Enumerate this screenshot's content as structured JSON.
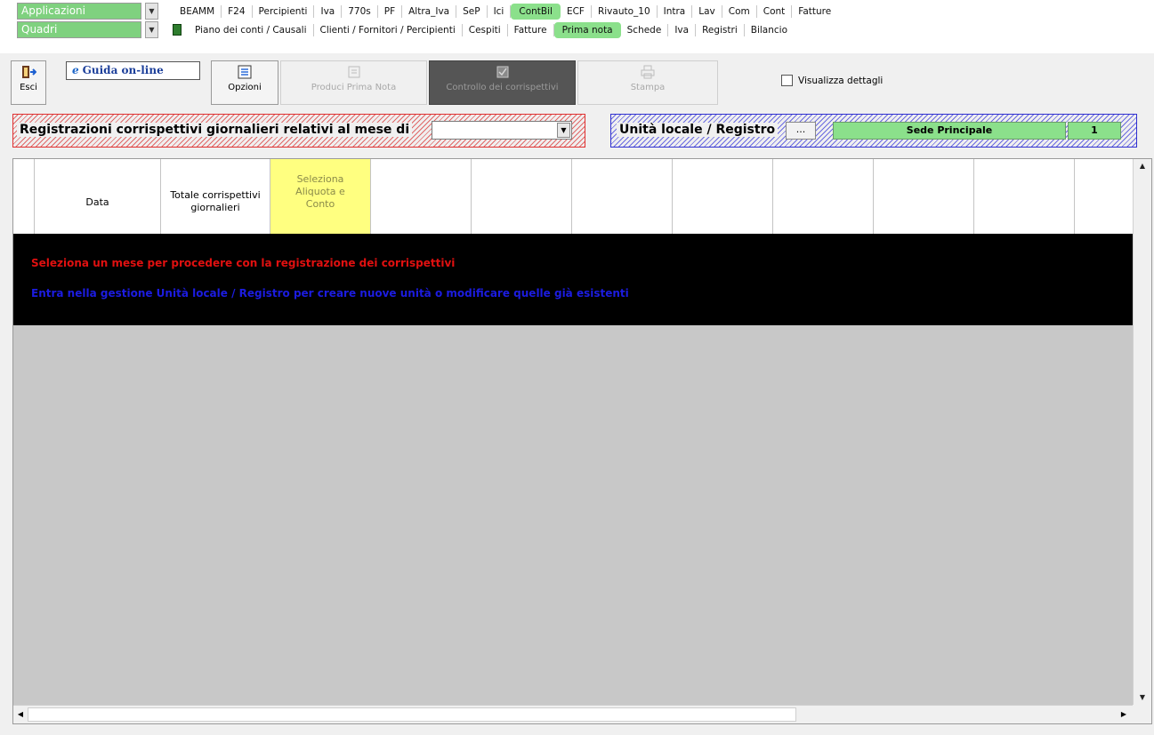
{
  "topbar": {
    "applicazioni": "Applicazioni",
    "quadri": "Quadri",
    "apps": [
      "BEAMM",
      "F24",
      "Percipienti",
      "Iva",
      "770s",
      "PF",
      "Altra_Iva",
      "SeP",
      "Ici",
      "ContBil",
      "ECF",
      "Rivauto_10",
      "Intra",
      "Lav",
      "Com",
      "Cont",
      "Fatture"
    ],
    "active_app": "ContBil",
    "sections": [
      "Piano dei conti / Causali",
      "Clienti / Fornitori / Percipienti",
      "Cespiti",
      "Fatture",
      "Prima nota",
      "Schede",
      "Iva",
      "Registri",
      "Bilancio"
    ],
    "active_section": "Prima nota"
  },
  "toolbar": {
    "esci": "Esci",
    "guida": "Guida on-line",
    "opzioni": "Opzioni",
    "produci": "Produci Prima Nota",
    "controllo": "Controllo dei corrispettivi",
    "stampa": "Stampa",
    "visualizza": "Visualizza dettagli"
  },
  "filter": {
    "month_label": "Registrazioni corrispettivi giornalieri relativi al mese di",
    "month_value": "",
    "unit_label": "Unità locale / Registro",
    "dots": "...",
    "sede": "Sede Principale",
    "registro_num": "1"
  },
  "grid": {
    "col_data": "Data",
    "col_totale": "Totale corrispettivi giornalieri",
    "col_seleziona": "Seleziona Aliquota e Conto",
    "msg_red": "Seleziona un mese per procedere con la registrazione dei corrispettivi",
    "msg_blue": "Entra nella gestione Unità locale / Registro per creare nuove unità o modificare quelle già esistenti"
  },
  "colors": {
    "accent_green": "#8be08b",
    "message_red": "#e01010",
    "message_blue": "#1c1ce0"
  }
}
